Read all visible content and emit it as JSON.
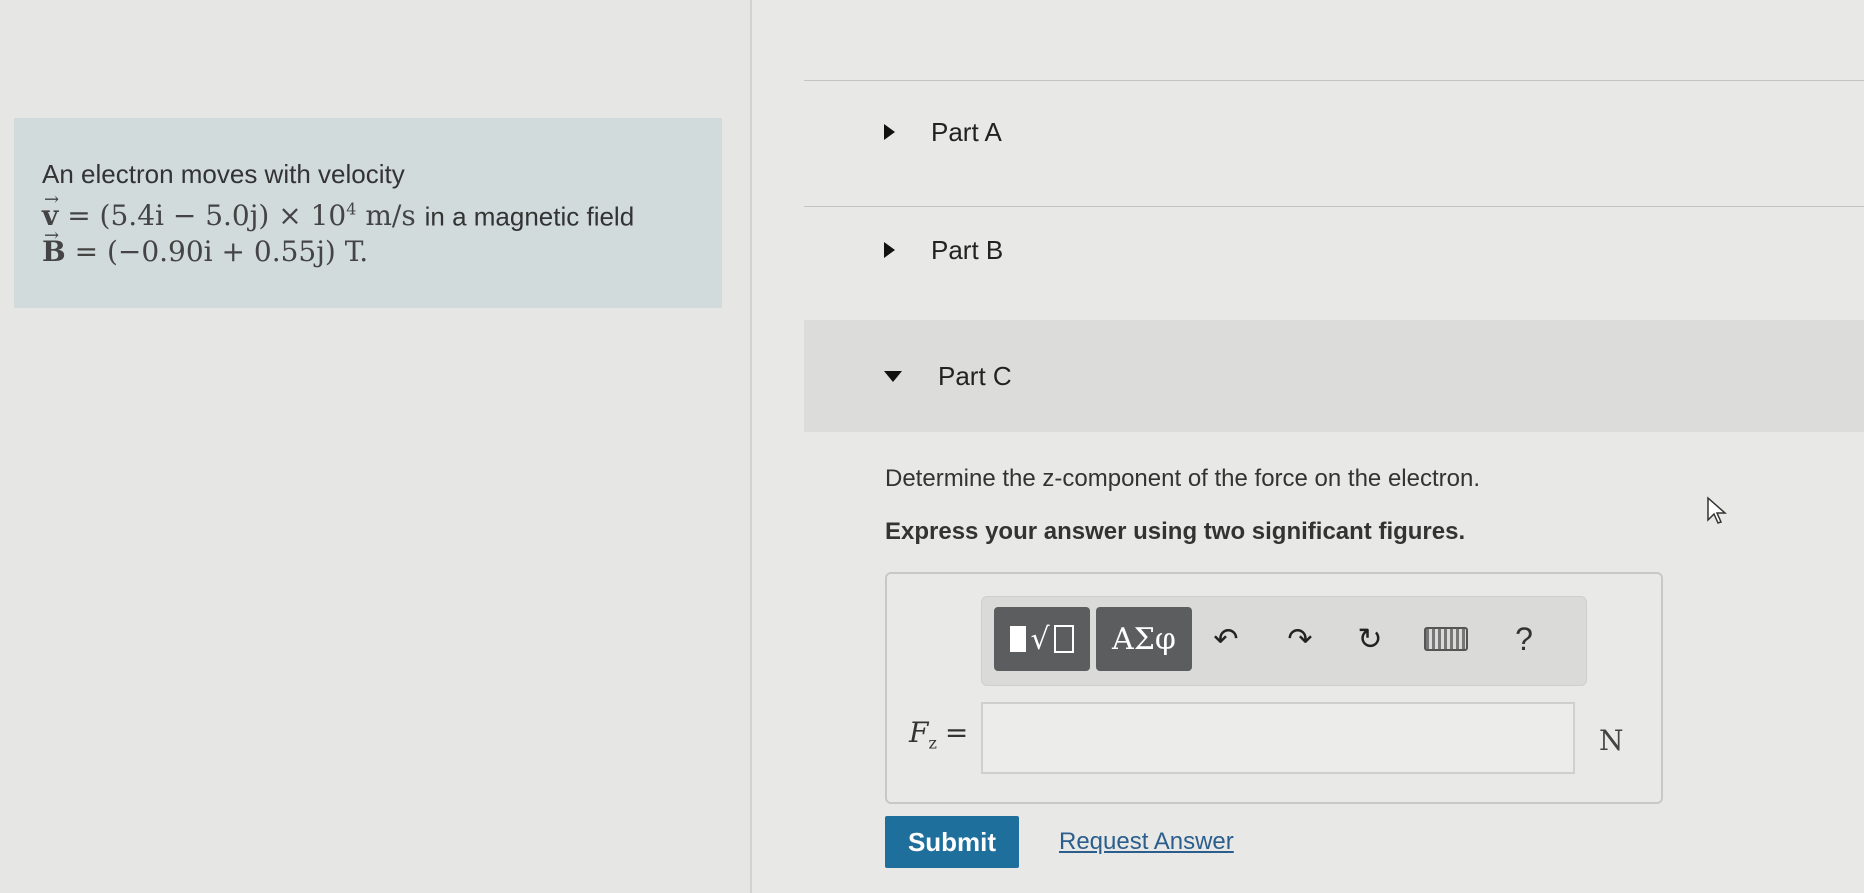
{
  "problem": {
    "intro": "An electron moves with velocity",
    "velocity_symbol": "v",
    "velocity_expr": "= (5.4i − 5.0j) × 10",
    "velocity_exp": "4",
    "velocity_units": " m/s",
    "velocity_tail": " in a magnetic field",
    "field_symbol": "B",
    "field_expr": "= (−0.90i + 0.55j) T."
  },
  "parts": [
    {
      "label": "Part A",
      "expanded": false
    },
    {
      "label": "Part B",
      "expanded": false
    },
    {
      "label": "Part C",
      "expanded": true
    }
  ],
  "part_c": {
    "question": "Determine the z-component of the force on the electron.",
    "instruction": "Express your answer using two significant figures.",
    "toolbar": {
      "symbols_label": "ΑΣφ",
      "undo_glyph": "↶",
      "redo_glyph": "↷",
      "reset_glyph": "↻",
      "help_glyph": "?"
    },
    "variable": "F",
    "variable_sub": "z",
    "equals": "=",
    "input_value": "",
    "unit": "N",
    "submit_label": "Submit",
    "request_label": "Request Answer"
  }
}
